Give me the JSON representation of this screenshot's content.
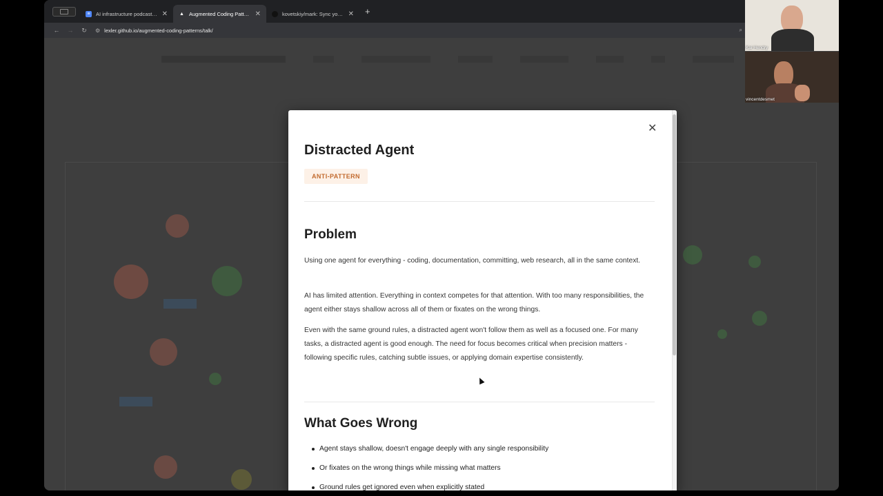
{
  "browser": {
    "tabs": [
      {
        "title": "AI infrastructure podcast - G",
        "icon": "doc-icon",
        "color": "#4f86f7",
        "active": false
      },
      {
        "title": "Augmented Coding Patterns",
        "icon": "triangle-icon",
        "color": "#ffffff",
        "active": true
      },
      {
        "title": "kovetskiy/mark: Sync your m",
        "icon": "github-icon",
        "color": "#222222",
        "active": false
      }
    ],
    "url": "lexler.github.io/augmented-coding-patterns/talk/"
  },
  "modal": {
    "title": "Distracted Agent",
    "badge": "ANTI-PATTERN",
    "problem_heading": "Problem",
    "problem_paragraphs": [
      "Using one agent for everything - coding, documentation, committing, web research, all in the same context.",
      "AI has limited attention. Everything in context competes for that attention. With too many responsibilities, the agent either stays shallow across all of them or fixates on the wrong things.",
      "Even with the same ground rules, a distracted agent won't follow them as well as a focused one. For many tasks, a distracted agent is good enough. The need for focus becomes critical when precision matters - following specific rules, catching subtle issues, or applying domain expertise consistently."
    ],
    "wrong_heading": "What Goes Wrong",
    "wrong_items": [
      "Agent stays shallow, doesn't engage deeply with any single responsibility",
      "Or fixates on the wrong things while missing what matters",
      "Ground rules get ignored even when explicitly stated"
    ]
  },
  "participants": [
    {
      "name": "Kai Hendry"
    },
    {
      "name": "vincentdesmet"
    }
  ],
  "colors": {
    "badge_bg": "#fdf1e7",
    "badge_text": "#c26b2f"
  }
}
